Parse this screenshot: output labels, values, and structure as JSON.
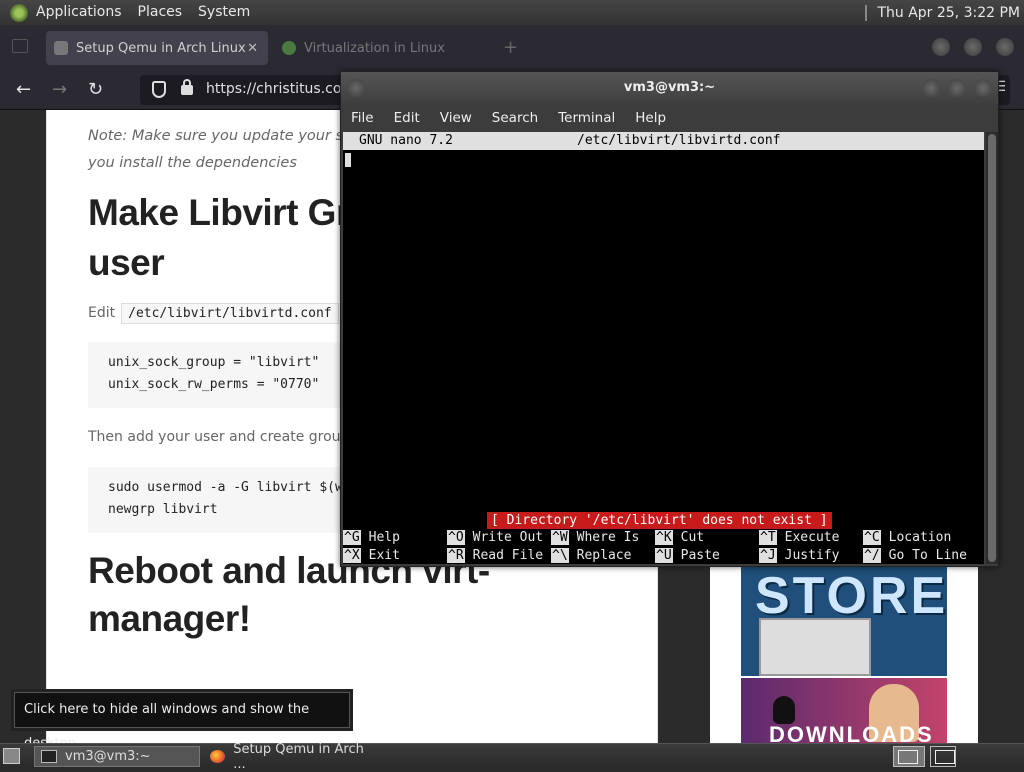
{
  "top_panel": {
    "applications": "Applications",
    "places": "Places",
    "system": "System",
    "clock": "Thu Apr 25,  3:22 PM"
  },
  "browser": {
    "tabs": [
      {
        "title": "Setup Qemu in Arch Linux",
        "active": true
      },
      {
        "title": "Virtualization in Linux",
        "active": false
      }
    ],
    "close_glyph": "✕",
    "new_tab_glyph": "+",
    "back_glyph": "←",
    "forward_glyph": "→",
    "reload_glyph": "↻",
    "menu_glyph": "☰",
    "url": "https://christitus.com"
  },
  "article": {
    "note_line1": "Note: Make sure you update your sys",
    "note_line2": "you install the dependencies",
    "heading1_line1": "Make Libvirt Gr",
    "heading1_line2": "user",
    "edit_label": "Edit",
    "edit_path": "/etc/libvirt/libvirtd.conf",
    "code1": "unix_sock_group = \"libvirt\"\nunix_sock_rw_perms = \"0770\"",
    "then_text": "Then add your user and create group",
    "code2": "sudo usermod -a -G libvirt $(w\nnewgrp libvirt",
    "heading2_line1": "Reboot and launch virt-",
    "heading2_line2": "manager!"
  },
  "sidebar_ads": {
    "ad1_text": "STORE",
    "ad2_text": "DOWNLOADS"
  },
  "terminal": {
    "title": "vm3@vm3:~",
    "menu": [
      "File",
      "Edit",
      "View",
      "Search",
      "Terminal",
      "Help"
    ],
    "nano_version": "GNU nano 7.2",
    "nano_file": "/etc/libvirt/libvirtd.conf",
    "status": "[ Directory '/etc/libvirt' does not exist ]",
    "shortcuts_row1": [
      {
        "key": "^G",
        "label": "Help"
      },
      {
        "key": "^O",
        "label": "Write Out"
      },
      {
        "key": "^W",
        "label": "Where Is"
      },
      {
        "key": "^K",
        "label": "Cut"
      },
      {
        "key": "^T",
        "label": "Execute"
      },
      {
        "key": "^C",
        "label": "Location"
      }
    ],
    "shortcuts_row2": [
      {
        "key": "^X",
        "label": "Exit"
      },
      {
        "key": "^R",
        "label": "Read File"
      },
      {
        "key": "^\\",
        "label": "Replace"
      },
      {
        "key": "^U",
        "label": "Paste"
      },
      {
        "key": "^J",
        "label": "Justify"
      },
      {
        "key": "^/",
        "label": "Go To Line"
      }
    ]
  },
  "tooltip": "Click here to hide all windows and show the desktop.",
  "taskbar": {
    "task_terminal": "vm3@vm3:~",
    "task_firefox": "Setup Qemu in Arch ..."
  }
}
